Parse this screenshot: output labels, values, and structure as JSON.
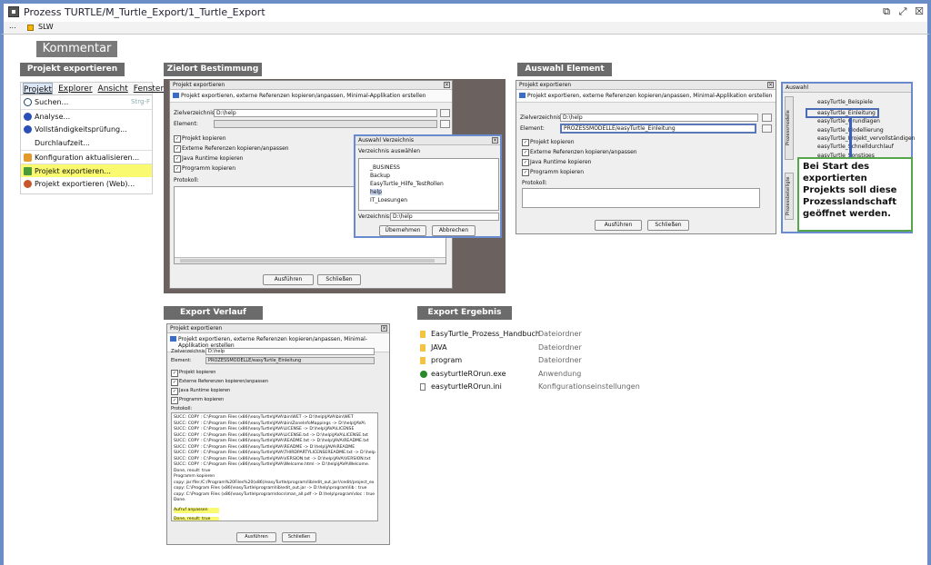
{
  "window": {
    "title": "Prozess TURTLE/M_Turtle_Export/1_Turtle_Export",
    "sub_dots": "...",
    "sub_label": "SLW"
  },
  "kommentar": "Kommentar",
  "sections": {
    "projekt_exportieren": "Projekt exportieren",
    "zielort": "Zielort Bestimmung",
    "auswahl_element": "Auswahl Element",
    "export_verlauf": "Export  Verlauf",
    "export_ergebnis": "Export Ergebnis"
  },
  "menu": {
    "bar": [
      "Projekt",
      "Explorer",
      "Ansicht",
      "Fenster"
    ],
    "items": [
      {
        "label": "Suchen...",
        "shortcut": "Strg-F"
      },
      {
        "label": "Analyse..."
      },
      {
        "label": "Vollständigkeitsprüfung..."
      },
      {
        "label": "Durchlaufzeit..."
      },
      {
        "label": "Konfiguration aktualisieren..."
      },
      {
        "label": "Projekt exportieren..."
      },
      {
        "label": "Projekt exportieren (Web)..."
      }
    ]
  },
  "dialog": {
    "title": "Projekt exportieren",
    "header": "Projekt exportieren, externe Referenzen kopieren/anpassen, Minimal-Applikation erstellen",
    "zielverzeichnis_label": "Zielverzeichnis:",
    "zielverzeichnis_value": "D:\\help",
    "element_label": "Element:",
    "element_value": "PROZESSMODELLE/easyTurtle_Einleitung",
    "checks": [
      "Projekt kopieren",
      "Externe Referenzen kopieren/anpassen",
      "Java Runtime kopieren",
      "Programm kopieren"
    ],
    "protokoll_label": "Protokoll:",
    "run_button": "Ausführen",
    "close_button": "Schließen"
  },
  "verzeichnis_dialog": {
    "title": "Auswahl Verzeichnis",
    "subtitle": "Verzeichnis auswählen",
    "tree": [
      "_BUSINESS",
      "Backup",
      "EasyTurtle_Hilfe_TestRollen",
      "help",
      "IT_Loesungen"
    ],
    "verzeichnis_label": "Verzeichnis:",
    "verzeichnis_value": "D:\\help",
    "ok_button": "Übernehmen",
    "cancel_button": "Abbrechen"
  },
  "auswahl_panel": {
    "title": "Auswahl",
    "tab_label": "Prozessmodelle",
    "tab_label2": "Prozessbeteiligte",
    "items": [
      "easyTurtle_Beispiele",
      "easyTurtle_Einleitung",
      "easyTurtle_Grundlagen",
      "easyTurtle_Modellierung",
      "easyTurtle_Projekt_vervollständigen",
      "easyTurtle_Schnelldurchlauf",
      "easyTurtle_Sonstiges"
    ],
    "note": "Bei Start des exportierten Projekts soll diese Prozesslandschaft geöffnet werden."
  },
  "log_lines": [
    "SUCC: COPY : C:\\Program Files (x86)\\easyTurtle\\JAVA\\bin\\WET -> D:\\help\\JAVA\\bin\\WET",
    "SUCC: COPY : C:\\Program Files (x86)\\easyTurtle\\JAVA\\bin\\ZoneInfoMappings -> D:\\help\\JAVA\\",
    "SUCC: COPY : C:\\Program Files (x86)\\easyTurtle\\JAVA\\LICENSE -> D:\\help\\JAVA\\LICENSE",
    "SUCC: COPY : C:\\Program Files (x86)\\easyTurtle\\JAVA\\LICENSE.txt -> D:\\help\\JAVA\\LICENSE.txt",
    "SUCC: COPY : C:\\Program Files (x86)\\easyTurtle\\JAVA\\README.txt -> D:\\help\\JAVA\\README.txt",
    "SUCC: COPY : C:\\Program Files (x86)\\easyTurtle\\JAVA\\README -> D:\\help\\JAVA\\README",
    "SUCC: COPY : C:\\Program Files (x86)\\easyTurtle\\JAVA\\THIRDPARTYLICENSEREADME.txt -> D:\\help",
    "SUCC: COPY : C:\\Program Files (x86)\\easyTurtle\\JAVA\\VERSION.txt -> D:\\help\\JAVA\\VERSION.txt",
    "SUCC: COPY : C:\\Program Files (x86)\\easyTurtle\\JAVA\\Welcome.html -> D:\\help\\JAVA\\Welcome.",
    "Done, result: true",
    "Programm kopieren",
    "copy: jar:file:/C:/Program%20Files%20(x86)/easyTurtle/program/lib/edit_out.jar!/cedit/project_ex",
    "copy: C:\\Program Files (x86)\\easyTurtle\\program\\lib\\edit_out.jar -> D:\\help\\program\\lib : true",
    "copy: C:\\Program Files (x86)\\easyTurtle\\program\\docs\\man_all.pdf -> D:\\help\\program\\doc : true",
    "Done.",
    "Aufruf anpassen",
    "Done, result: true"
  ],
  "ergebnis": [
    {
      "name": "EasyTurtle_Prozess_Handbuch",
      "type": "Dateiordner",
      "icon": "folder-icon"
    },
    {
      "name": "JAVA",
      "type": "Dateiordner",
      "icon": "folder-icon"
    },
    {
      "name": "program",
      "type": "Dateiordner",
      "icon": "folder-icon"
    },
    {
      "name": "easyturtleROrun.exe",
      "type": "Anwendung",
      "icon": "turtle-app-icon"
    },
    {
      "name": "easyturtleROrun.ini",
      "type": "Konfigurationseinstellungen",
      "icon": "ini-file-icon"
    }
  ]
}
